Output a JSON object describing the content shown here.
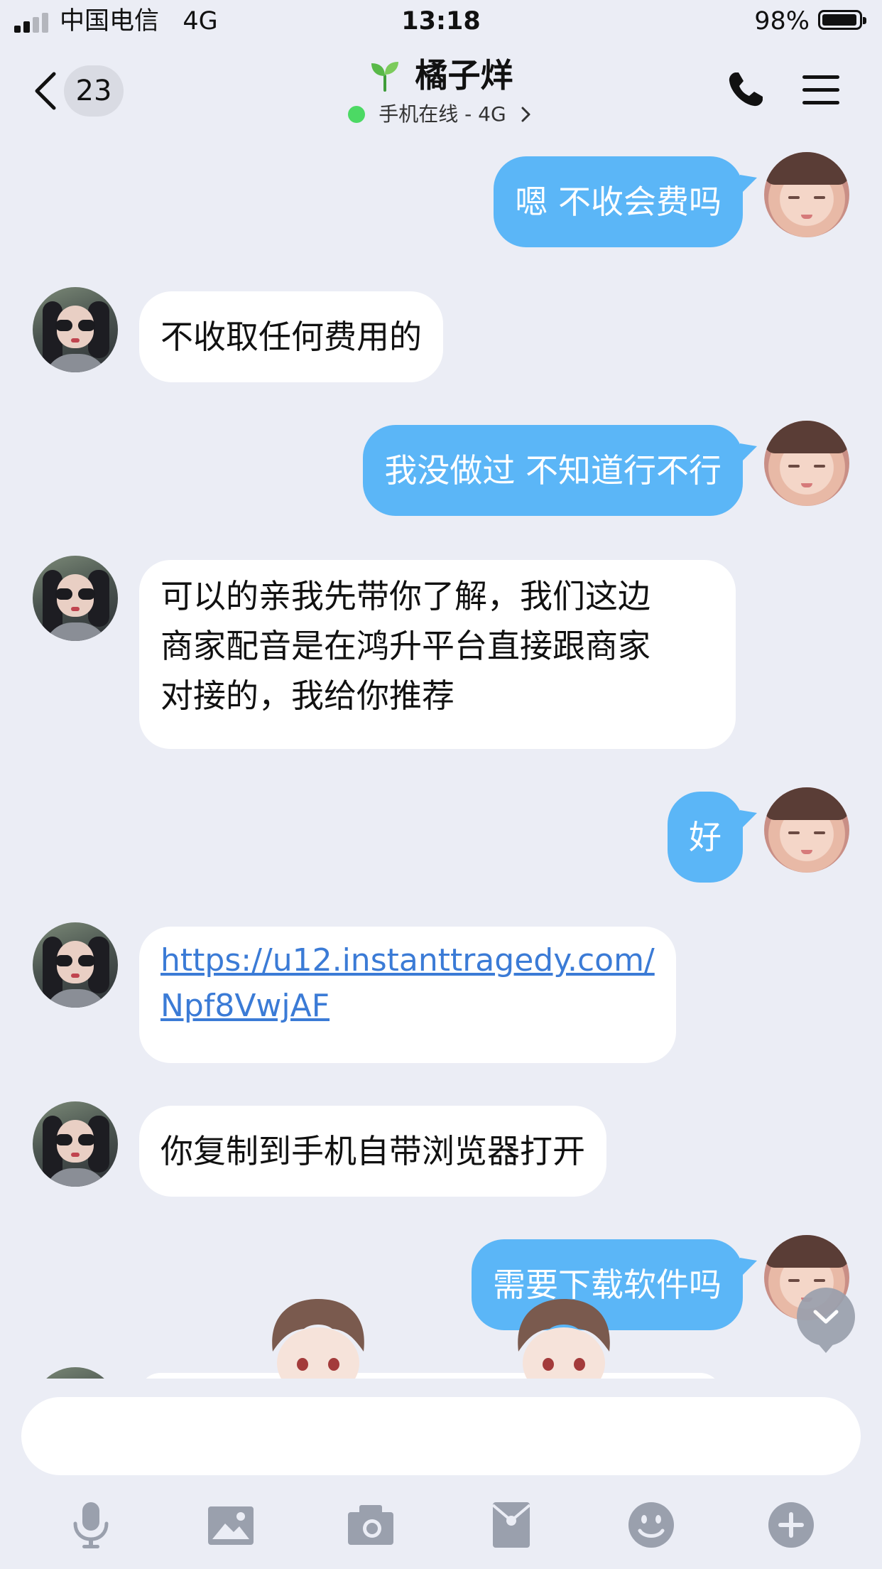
{
  "status_bar": {
    "carrier": "中国电信",
    "network": "4G",
    "time": "13:18",
    "battery": "98%"
  },
  "header": {
    "unread_count": "23",
    "title": "橘子烊",
    "online_status": "手机在线 - 4G",
    "icons": [
      "back-chevron-icon",
      "sprout-icon",
      "phone-icon",
      "menu-icon"
    ]
  },
  "messages": [
    {
      "from": "me",
      "text": "嗯 不收会费吗"
    },
    {
      "from": "contact",
      "text": "不收取任何费用的"
    },
    {
      "from": "me",
      "text": "我没做过 不知道行不行"
    },
    {
      "from": "contact",
      "lines": [
        "可以的亲我先带你了解，我们这边",
        "商家配音是在鸿升平台直接跟商家",
        "对接的，我给你推荐"
      ]
    },
    {
      "from": "me",
      "text": "好"
    },
    {
      "from": "contact",
      "link_lines": [
        "https://u12.instanttragedy.com/",
        "Npf8VwjAF"
      ]
    },
    {
      "from": "contact",
      "text": "你复制到手机自带浏览器打开"
    },
    {
      "from": "me",
      "text": "需要下载软件吗"
    }
  ],
  "input_bar": {
    "value": "",
    "tools": [
      "microphone-icon",
      "image-icon",
      "camera-icon",
      "red-packet-icon",
      "emoji-icon",
      "plus-icon"
    ]
  },
  "colors": {
    "outgoing_bubble": "#5bb6f7",
    "incoming_bubble": "#ffffff",
    "background": "#ebedf5",
    "link": "#3b7bd6",
    "online_dot": "#4cd964"
  }
}
